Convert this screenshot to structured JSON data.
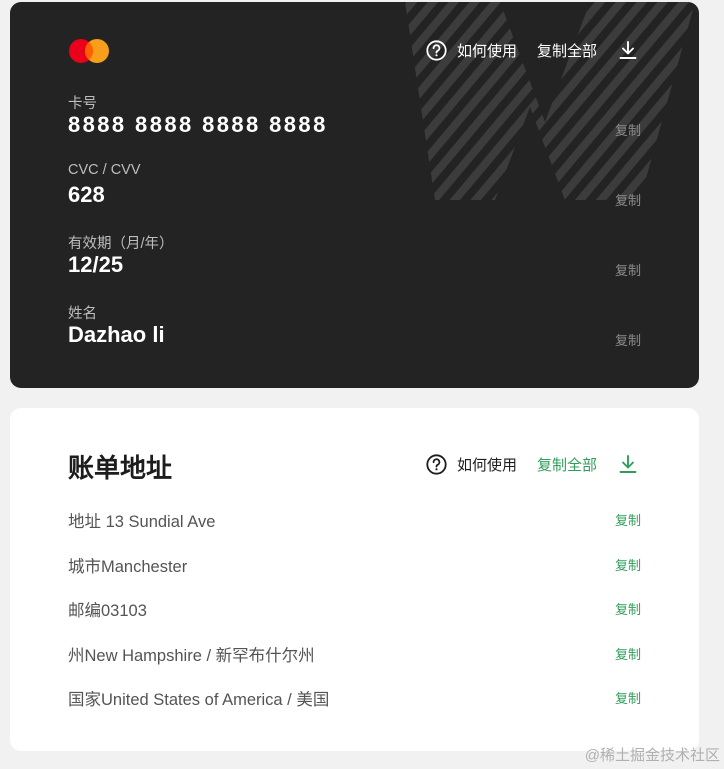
{
  "card": {
    "actions": {
      "help_label": "如何使用",
      "copy_all_label": "复制全部"
    },
    "fields": [
      {
        "label": "卡号",
        "value": "8888 8888 8888 8888",
        "copy": "复制"
      },
      {
        "label": "CVC / CVV",
        "value": "628",
        "copy": "复制"
      },
      {
        "label": "有效期（月/年）",
        "value": "12/25",
        "copy": "复制"
      },
      {
        "label": "姓名",
        "value": "Dazhao li",
        "copy": "复制"
      }
    ],
    "colors": {
      "background": "#232323",
      "mastercard_red": "#eb001b",
      "mastercard_orange": "#f79e1b"
    }
  },
  "billing": {
    "title": "账单地址",
    "actions": {
      "help_label": "如何使用",
      "copy_all_label": "复制全部"
    },
    "rows": [
      {
        "text": "地址 13 Sundial Ave",
        "copy": "复制"
      },
      {
        "text": "城市Manchester",
        "copy": "复制"
      },
      {
        "text": "邮编03103",
        "copy": "复制"
      },
      {
        "text": "州New Hampshire / 新罕布什尔州",
        "copy": "复制"
      },
      {
        "text": "国家United States of America / 美国",
        "copy": "复制"
      }
    ],
    "colors": {
      "accent": "#2f9e5b"
    }
  },
  "watermark": "@稀土掘金技术社区",
  "icons": {
    "logo": "mastercard-logo-icon",
    "help": "help-circle-icon",
    "download": "download-icon"
  }
}
